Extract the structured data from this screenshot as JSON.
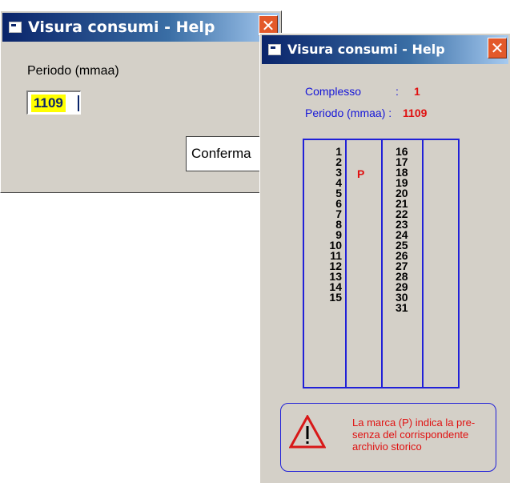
{
  "back_window": {
    "title": "Visura consumi - Help",
    "close_glyph": "✕",
    "periodo_label": "Periodo (mmaa)",
    "periodo_value": "1109",
    "conferma_label": "Conferma"
  },
  "front_window": {
    "title": "Visura consumi - Help",
    "close_glyph": "✕",
    "complesso_label": "Complesso",
    "complesso_sep": ":",
    "complesso_value": "1",
    "periodo_label": "Periodo  (mmaa) :",
    "periodo_value": "1109",
    "days_left": [
      "1",
      "2",
      "3",
      "4",
      "5",
      "6",
      "7",
      "8",
      "9",
      "10",
      "11",
      "12",
      "13",
      "14",
      "15"
    ],
    "days_right": [
      "16",
      "17",
      "18",
      "19",
      "20",
      "21",
      "22",
      "23",
      "24",
      "25",
      "26",
      "27",
      "28",
      "29",
      "30",
      "31"
    ],
    "mark": "P",
    "note_lines": [
      "La marca (P) indica la pre-",
      "senza del corrispondente",
      "archivio storico"
    ]
  },
  "icons": {
    "title_icon": "window-app-icon",
    "warning": "warning-triangle-icon"
  },
  "colors": {
    "label_blue": "#1616d8",
    "value_red": "#e01010",
    "grid_border": "#2020d8",
    "highlight": "#ffff00"
  }
}
